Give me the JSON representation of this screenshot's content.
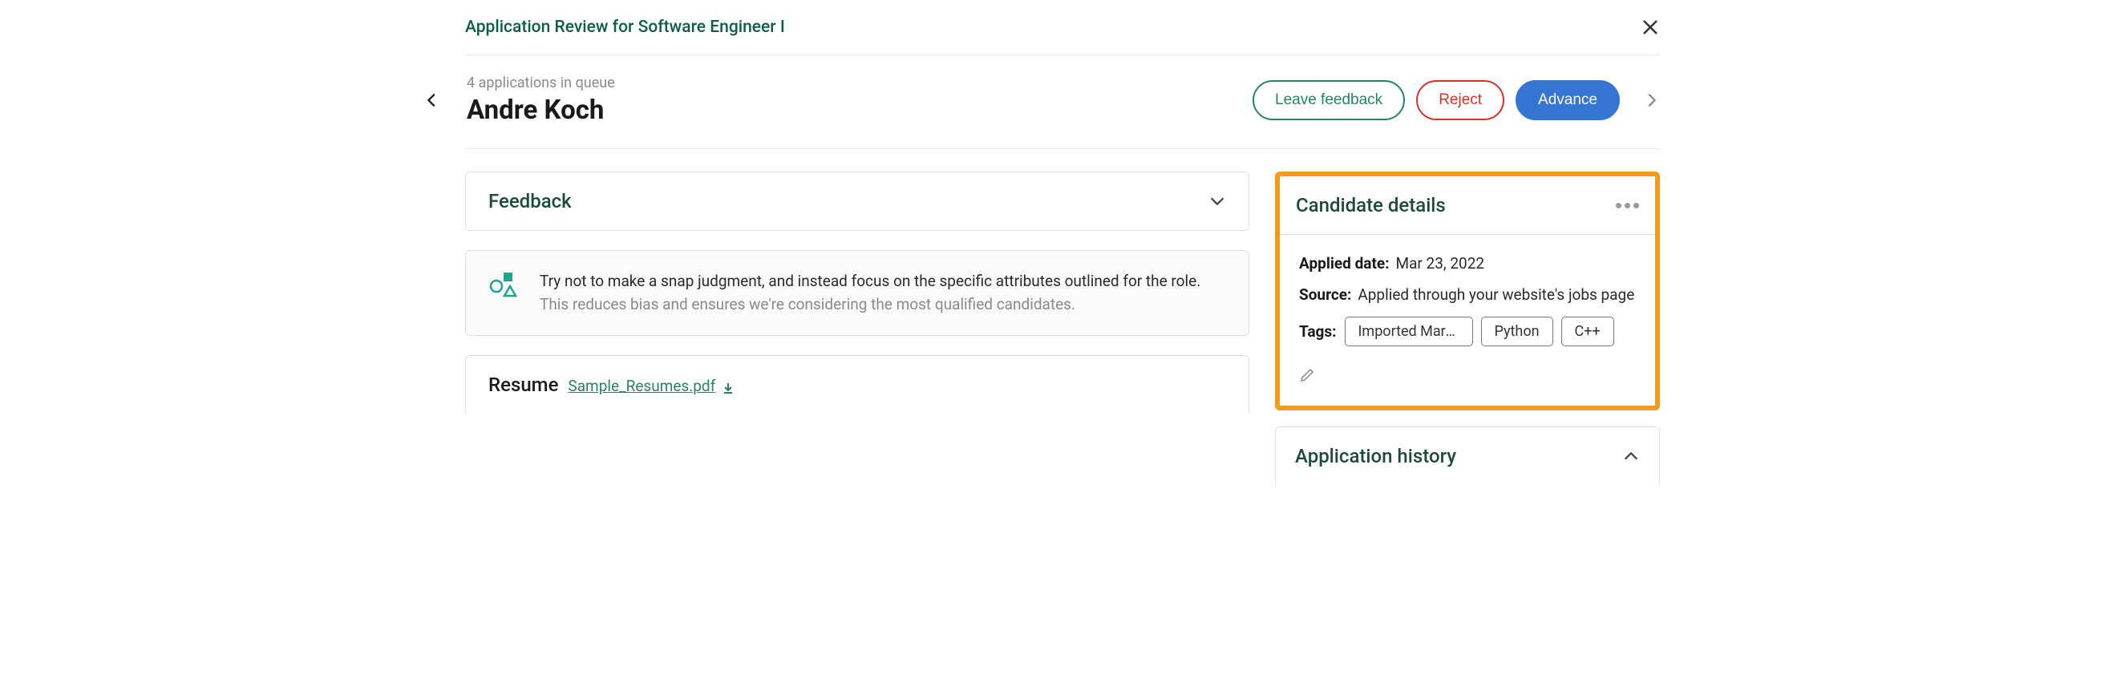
{
  "topbar": {
    "title": "Application Review for Software Engineer I"
  },
  "header": {
    "queue": "4 applications in queue",
    "name": "Andre Koch",
    "actions": {
      "feedback": "Leave feedback",
      "reject": "Reject",
      "advance": "Advance"
    }
  },
  "feedback_section": {
    "title": "Feedback"
  },
  "banner": {
    "line1": "Try not to make a snap judgment, and instead focus on the specific attributes outlined for the role.",
    "line2": "This reduces bias and ensures we're considering the most qualified candidates."
  },
  "resume": {
    "title": "Resume",
    "file": "Sample_Resumes.pdf"
  },
  "details": {
    "title": "Candidate details",
    "applied_label": "Applied date:",
    "applied_value": "Mar 23, 2022",
    "source_label": "Source:",
    "source_value": "Applied through your website's jobs page",
    "tags_label": "Tags:",
    "tags": [
      "Imported Marc…",
      "Python",
      "C++"
    ]
  },
  "history": {
    "title": "Application history"
  }
}
